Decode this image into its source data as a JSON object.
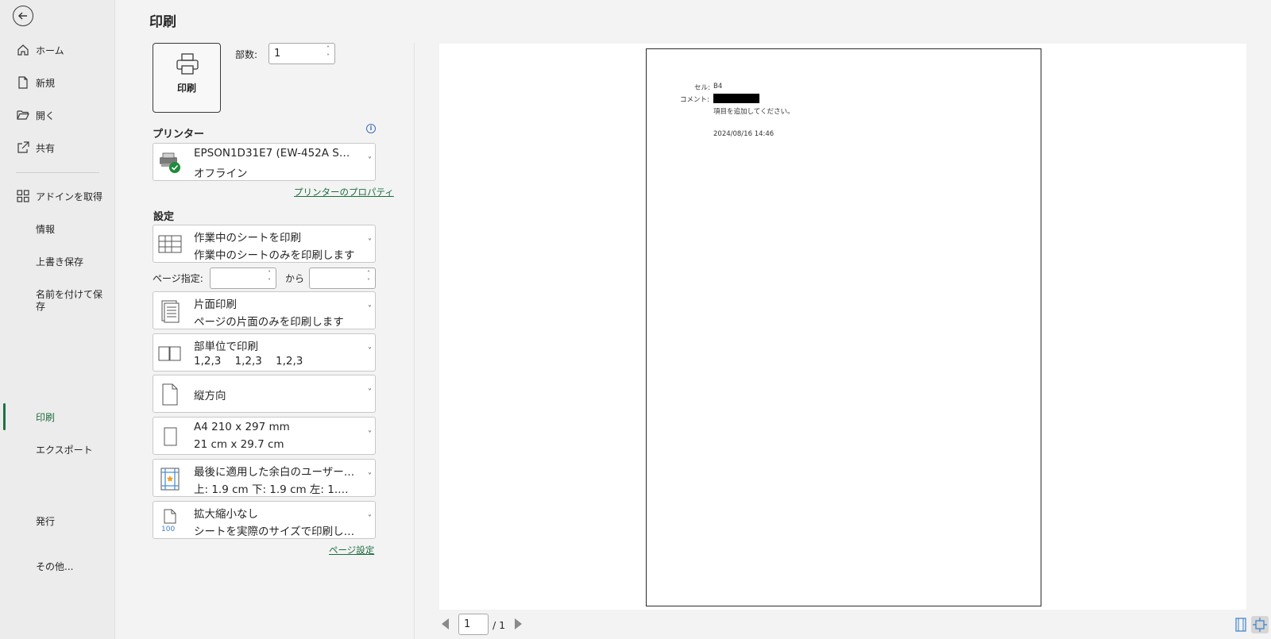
{
  "nav": {
    "items": [
      {
        "label": "ホーム"
      },
      {
        "label": "新規"
      },
      {
        "label": "開く"
      },
      {
        "label": "共有"
      },
      {
        "label": "アドインを取得"
      },
      {
        "label": "情報"
      },
      {
        "label": "上書き保存"
      },
      {
        "label": "名前を付けて保存"
      },
      {
        "label": "印刷"
      },
      {
        "label": "エクスポート"
      },
      {
        "label": "発行"
      },
      {
        "label": "その他..."
      }
    ]
  },
  "header": {
    "title": "印刷"
  },
  "print_button": {
    "label": "印刷"
  },
  "copies": {
    "label": "部数:",
    "value": "1"
  },
  "printer": {
    "section_title": "プリンター",
    "name": "EPSON1D31E7 (EW-452A S…",
    "status": "オフライン",
    "properties_link": "プリンターのプロパティ"
  },
  "settings": {
    "section_title": "設定",
    "what_to_print": {
      "line1": "作業中のシートを印刷",
      "line2": "作業中のシートのみを印刷します"
    },
    "pages": {
      "label": "ページ指定:",
      "to_label": "から"
    },
    "sides": {
      "line1": "片面印刷",
      "line2": "ページの片面のみを印刷します"
    },
    "collation": {
      "line1": "部単位で印刷",
      "line2": "1,2,3    1,2,3    1,2,3"
    },
    "orientation": {
      "line1": "縦方向"
    },
    "paper_size": {
      "line1": "A4 210 x 297 mm",
      "line2": "21 cm x 29.7 cm"
    },
    "margins": {
      "line1": "最後に適用した余白のユーザー設定",
      "line2": "上: 1.9 cm 下: 1.9 cm 左: 1.…"
    },
    "scaling": {
      "line1": "拡大縮小なし",
      "line2": "シートを実際のサイズで印刷します",
      "icon_text": "100"
    },
    "page_setup_link": "ページ設定"
  },
  "preview": {
    "cell_label": "セル:",
    "cell_value": "B4",
    "comment_label": "コメント:",
    "comment_text": "項目を追加してください。",
    "timestamp": "2024/08/16 14:46"
  },
  "pager": {
    "current": "1",
    "total": "/ 1"
  }
}
